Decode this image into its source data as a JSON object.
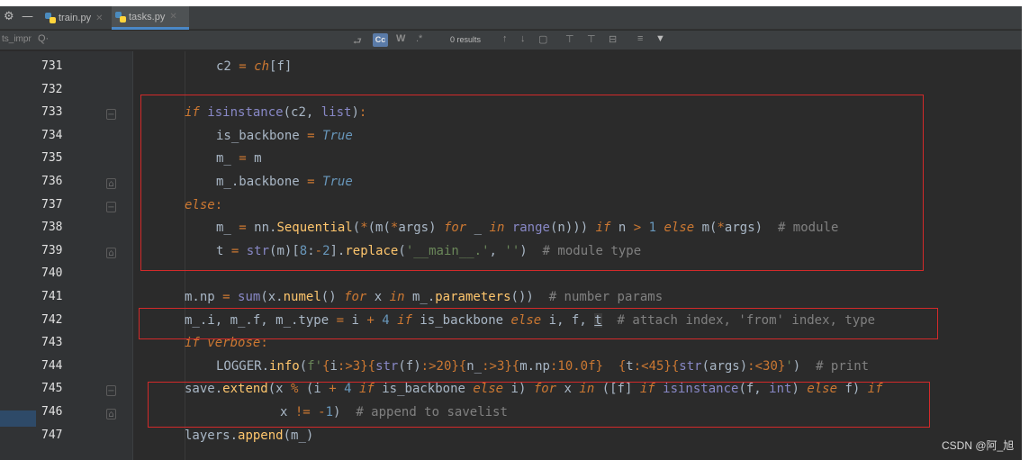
{
  "tabs": [
    {
      "label": "train.py",
      "active": false
    },
    {
      "label": "tasks.py",
      "active": true
    }
  ],
  "search": {
    "project_label": "ts_impr",
    "results_text": "0 results"
  },
  "lines": [
    {
      "num": "731"
    },
    {
      "num": "732"
    },
    {
      "num": "733"
    },
    {
      "num": "734"
    },
    {
      "num": "735"
    },
    {
      "num": "736"
    },
    {
      "num": "737"
    },
    {
      "num": "738"
    },
    {
      "num": "739"
    },
    {
      "num": "740"
    },
    {
      "num": "741"
    },
    {
      "num": "742"
    },
    {
      "num": "743"
    },
    {
      "num": "744"
    },
    {
      "num": "745"
    },
    {
      "num": "746"
    },
    {
      "num": "747"
    }
  ],
  "code": {
    "l731": "c2 = ch[f]",
    "c738": "# module",
    "c739": "# module type",
    "c741": "# number params",
    "c742": "# attach index, 'from' index, type",
    "c744": "# print",
    "c746": "# append to savelist"
  },
  "watermark": "CSDN @阿_旭",
  "colors": {
    "background": "#2b2b2b",
    "keyword": "#cc7832",
    "builtin": "#8888c6",
    "function": "#ffc66d",
    "number": "#6897bb",
    "string": "#6a8759",
    "comment": "#808080",
    "annotation_box": "#d22a2a"
  }
}
